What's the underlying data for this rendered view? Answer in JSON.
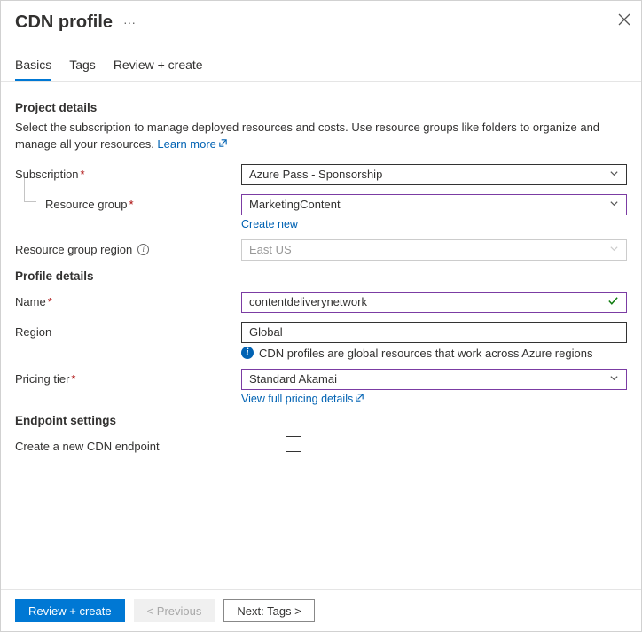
{
  "header": {
    "title": "CDN profile",
    "more": "···"
  },
  "tabs": {
    "basics": "Basics",
    "tags": "Tags",
    "review": "Review + create"
  },
  "project": {
    "title": "Project details",
    "desc": "Select the subscription to manage deployed resources and costs. Use resource groups like folders to organize and manage all your resources. ",
    "learn_more": "Learn more",
    "subscription_label": "Subscription",
    "subscription_value": "Azure Pass - Sponsorship",
    "rg_label": "Resource group",
    "rg_value": "MarketingContent",
    "create_new": "Create new",
    "rg_region_label": "Resource group region",
    "rg_region_value": "East US"
  },
  "profile": {
    "title": "Profile details",
    "name_label": "Name",
    "name_value": "contentdeliverynetwork",
    "region_label": "Region",
    "region_value": "Global",
    "region_hint": "CDN profiles are global resources that work across Azure regions",
    "pricing_label": "Pricing tier",
    "pricing_value": "Standard Akamai",
    "pricing_link": "View full pricing details"
  },
  "endpoint": {
    "title": "Endpoint settings",
    "create_label": "Create a new CDN endpoint"
  },
  "footer": {
    "review": "Review + create",
    "prev": "< Previous",
    "next": "Next: Tags >"
  }
}
